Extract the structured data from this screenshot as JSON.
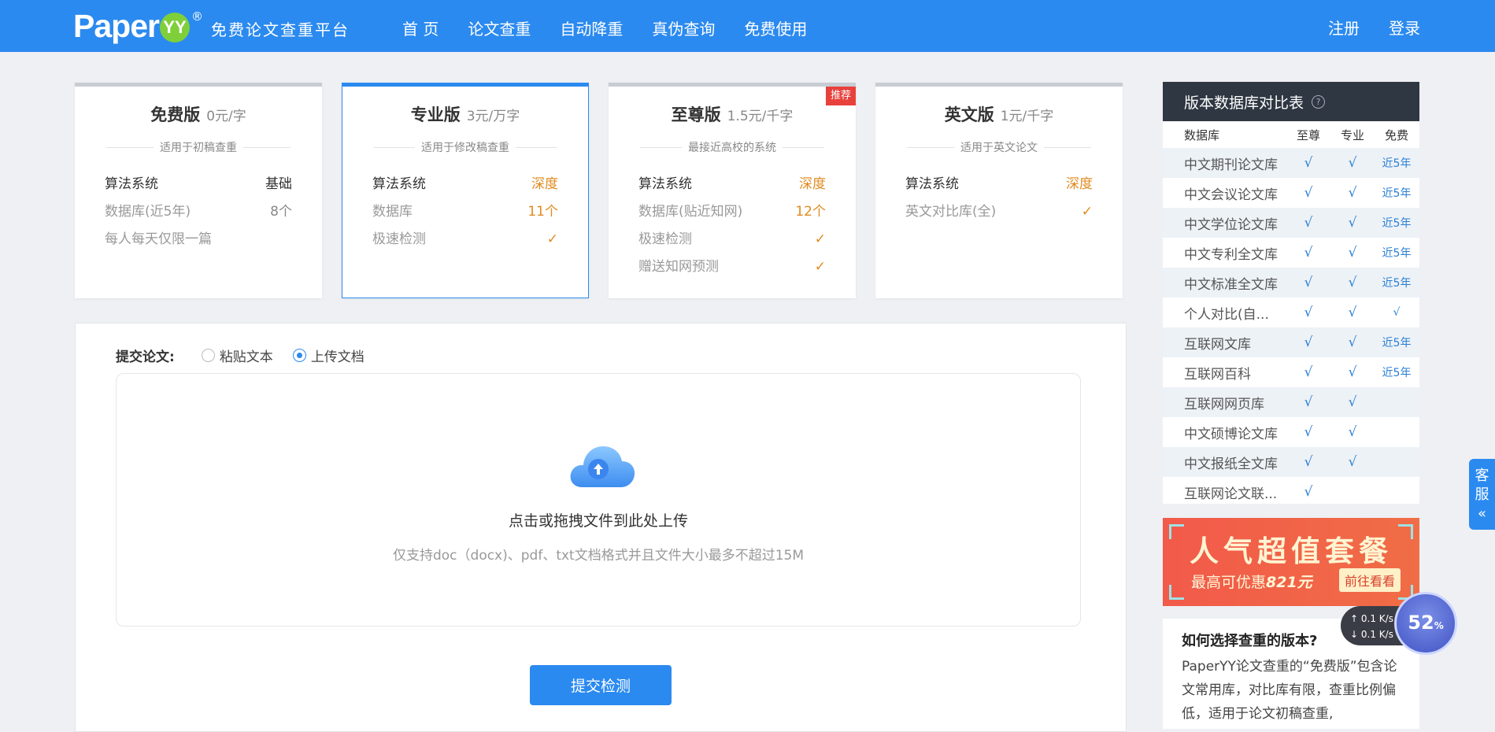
{
  "header": {
    "logo_word": "Paper",
    "logo_yy": "YY",
    "logo_reg": "®",
    "slogan": "免费论文查重平台",
    "nav": [
      "首 页",
      "论文查重",
      "自动降重",
      "真伪查询",
      "免费使用"
    ],
    "auth": {
      "register": "注册",
      "login": "登录"
    },
    "brand_color": "#2b8aef"
  },
  "plans": [
    {
      "name": "免费版",
      "price": "0元/字",
      "subtitle": "适用于初稿查重",
      "features": [
        [
          "算法系统",
          "基础"
        ],
        [
          "数据库(近5年)",
          "8个"
        ],
        [
          "每人每天仅限一篇",
          ""
        ]
      ]
    },
    {
      "name": "专业版",
      "price": "3元/万字",
      "subtitle": "适用于修改稿查重",
      "features": [
        [
          "算法系统",
          "深度"
        ],
        [
          "数据库",
          "11个"
        ],
        [
          "极速检测",
          "✓"
        ]
      ]
    },
    {
      "name": "至尊版",
      "price": "1.5元/千字",
      "subtitle": "最接近高校的系统",
      "badge": "推荐",
      "features": [
        [
          "算法系统",
          "深度"
        ],
        [
          "数据库(贴近知网)",
          "12个"
        ],
        [
          "极速检测",
          "✓"
        ],
        [
          "赠送知网预测",
          "✓"
        ]
      ]
    },
    {
      "name": "英文版",
      "price": "1元/千字",
      "subtitle": "适用于英文论文",
      "features": [
        [
          "算法系统",
          "深度"
        ],
        [
          "英文对比库(全)",
          "✓"
        ]
      ]
    }
  ],
  "upload": {
    "label": "提交论文:",
    "options": [
      "粘贴文本",
      "上传文档"
    ],
    "selected": "上传文档",
    "drop_title": "点击或拖拽文件到此处上传",
    "drop_hint": "仅支持doc（docx)、pdf、txt文档格式并且文件大小最多不超过15M",
    "submit": "提交检测",
    "cloud_icon": "cloud-upload-icon"
  },
  "db_compare": {
    "title": "版本数据库对比表",
    "help_icon": "?",
    "columns": [
      "数据库",
      "至尊",
      "专业",
      "免费"
    ],
    "rows": [
      [
        "中文期刊论文库",
        "√",
        "√",
        "近5年"
      ],
      [
        "中文会议论文库",
        "√",
        "√",
        "近5年"
      ],
      [
        "中文学位论文库",
        "√",
        "√",
        "近5年"
      ],
      [
        "中文专利全文库",
        "√",
        "√",
        "近5年"
      ],
      [
        "中文标准全文库",
        "√",
        "√",
        "近5年"
      ],
      [
        "个人对比(自...",
        "√",
        "√",
        "√"
      ],
      [
        "互联网文库",
        "√",
        "√",
        "近5年"
      ],
      [
        "互联网百科",
        "√",
        "√",
        "近5年"
      ],
      [
        "互联网网页库",
        "√",
        "√",
        ""
      ],
      [
        "中文硕博论文库",
        "√",
        "√",
        ""
      ],
      [
        "中文报纸全文库",
        "√",
        "√",
        ""
      ],
      [
        "互联网论文联...",
        "√",
        "",
        ""
      ]
    ]
  },
  "promo": {
    "title": "人气超值套餐",
    "sub_prefix": "最高可优惠",
    "sub_amount": "821元",
    "button": "前往看看"
  },
  "guide": {
    "title": "如何选择查重的版本?",
    "body": "PaperYY论文查重的“免费版”包含论文常用库，对比库有限，查重比例偏低，适用于论文初稿查重,"
  },
  "service_tab": {
    "line1": "客",
    "line2": "服",
    "arrow": "«"
  },
  "speed_widget": {
    "up": "0.1",
    "down": "0.1",
    "unit": "K/s",
    "percent": "52"
  }
}
